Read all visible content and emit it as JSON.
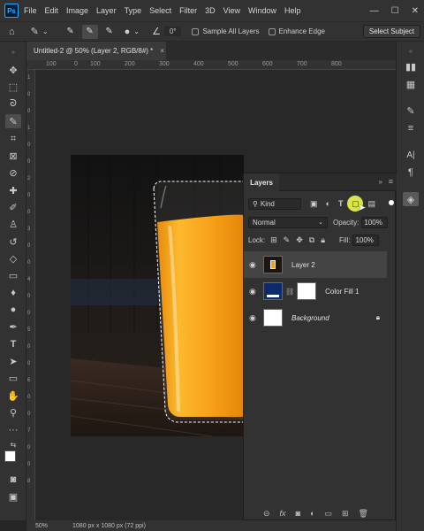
{
  "app": {
    "logo": "Ps"
  },
  "menu": [
    "File",
    "Edit",
    "Image",
    "Layer",
    "Type",
    "Select",
    "Filter",
    "3D",
    "View",
    "Window",
    "Help"
  ],
  "window_controls": [
    "—",
    "☐",
    "✕"
  ],
  "options": {
    "angle_value": "0°",
    "sample_all_layers": "Sample All Layers",
    "enhance_edge": "Enhance Edge",
    "select_subject": "Select Subject"
  },
  "document": {
    "tab_title": "Untitled-2 @ 50% (Layer 2, RGB/8#) *",
    "close": "×",
    "zoom": "50%",
    "doc_info": "1080 px x 1080 px (72 ppi)"
  },
  "ruler": {
    "top": [
      "100",
      "0",
      "100",
      "200",
      "300",
      "400",
      "500",
      "600",
      "700",
      "800"
    ],
    "left": [
      "1",
      "0",
      "0",
      "1",
      "0",
      "0",
      "2",
      "0",
      "0",
      "3",
      "0",
      "0",
      "4",
      "0",
      "0",
      "5",
      "0",
      "0",
      "6",
      "0",
      "0",
      "7",
      "0",
      "0",
      "8"
    ]
  },
  "layers_panel": {
    "title": "Layers",
    "filter_kind": "Kind",
    "blend_mode": "Normal",
    "opacity_label": "Opacity:",
    "opacity_value": "100%",
    "lock_label": "Lock:",
    "fill_label": "Fill:",
    "fill_value": "100%",
    "layers": [
      {
        "name": "Layer 2",
        "selected": true
      },
      {
        "name": "Color Fill 1",
        "selected": false
      },
      {
        "name": "Background",
        "selected": false,
        "italic": true
      }
    ]
  },
  "colors": {
    "accent_fill": "#0d2a6b",
    "juice": "#f4a21a",
    "cursor_highlight": "#d9e34a"
  }
}
